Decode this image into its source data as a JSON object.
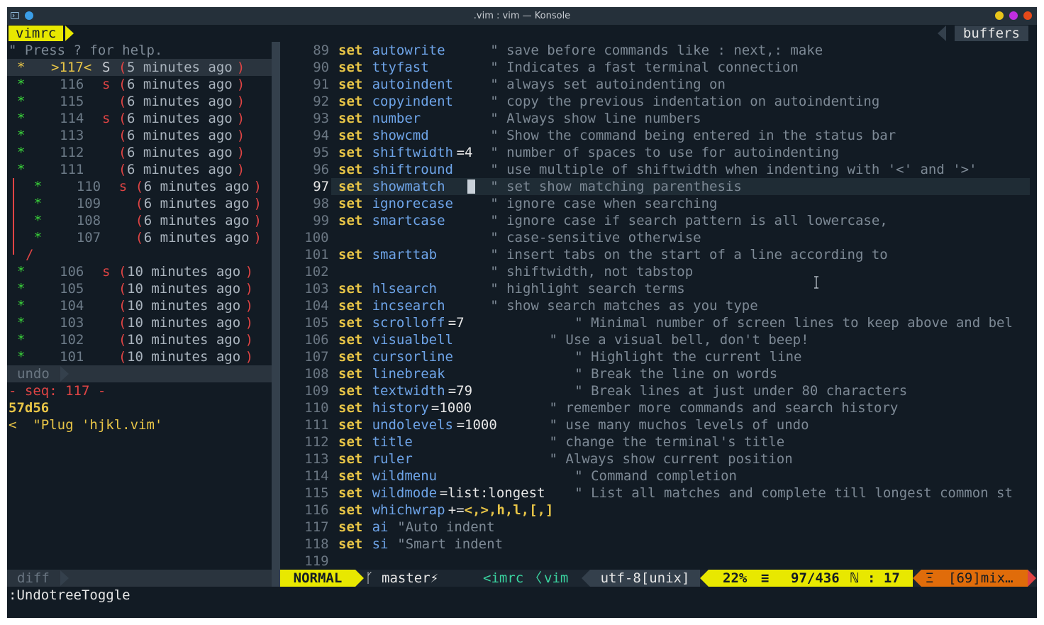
{
  "window": {
    "title": ".vim : vim — Konsole"
  },
  "colors": {
    "accent_yellow": "#e8e800",
    "status_orange": "#e06c0a",
    "bg": "#121b24"
  },
  "tabline": {
    "left_tab": "vimrc",
    "right_tab": "buffers"
  },
  "undotree": {
    "help": "\" Press ? for help.",
    "entries": [
      {
        "star": "*",
        "seq": ">117<",
        "flag": "S",
        "time": "5 minutes ago"
      },
      {
        "star": "*",
        "seq": "116",
        "flag": "s",
        "time": "6 minutes ago"
      },
      {
        "star": "*",
        "seq": "115",
        "flag": "",
        "time": "6 minutes ago"
      },
      {
        "star": "*",
        "seq": "114",
        "flag": "s",
        "time": "6 minutes ago"
      },
      {
        "star": "*",
        "seq": "113",
        "flag": "",
        "time": "6 minutes ago"
      },
      {
        "star": "*",
        "seq": "112",
        "flag": "",
        "time": "6 minutes ago"
      },
      {
        "star": "*",
        "seq": "111",
        "flag": "",
        "time": "6 minutes ago"
      },
      {
        "star": "*",
        "seq": "110",
        "flag": "s",
        "time": "6 minutes ago"
      },
      {
        "star": "*",
        "seq": "109",
        "flag": "",
        "time": "6 minutes ago"
      },
      {
        "star": "*",
        "seq": "108",
        "flag": "",
        "time": "6 minutes ago"
      },
      {
        "star": "*",
        "seq": "107",
        "flag": "",
        "time": "6 minutes ago"
      },
      {
        "star": "*",
        "seq": "106",
        "flag": "s",
        "time": "10 minutes ago"
      },
      {
        "star": "*",
        "seq": "105",
        "flag": "",
        "time": "10 minutes ago"
      },
      {
        "star": "*",
        "seq": "104",
        "flag": "",
        "time": "10 minutes ago"
      },
      {
        "star": "*",
        "seq": "103",
        "flag": "",
        "time": "10 minutes ago"
      },
      {
        "star": "*",
        "seq": "102",
        "flag": "",
        "time": "10 minutes ago"
      },
      {
        "star": "*",
        "seq": "101",
        "flag": "",
        "time": "10 minutes ago"
      }
    ],
    "branch_join": "/",
    "status": "undo",
    "diff_seq": "- seq: 117 -",
    "diff_hunk": "57d56",
    "diff_line": "<  \"Plug 'hjkl.vim'",
    "diff_status": "diff"
  },
  "editor": {
    "current_line": "97",
    "lines": [
      {
        "n": "89",
        "set": "set",
        "opt": "autowrite",
        "val": "",
        "com": "\" save before commands like : next,: make"
      },
      {
        "n": "90",
        "set": "set",
        "opt": "ttyfast",
        "val": "",
        "com": "\" Indicates a fast terminal connection"
      },
      {
        "n": "91",
        "set": "set",
        "opt": "autoindent",
        "val": "",
        "com": "\" always set autoindenting on"
      },
      {
        "n": "92",
        "set": "set",
        "opt": "copyindent",
        "val": "",
        "com": "\" copy the previous indentation on autoindenting"
      },
      {
        "n": "93",
        "set": "set",
        "opt": "number",
        "val": "",
        "com": "\" Always show line numbers"
      },
      {
        "n": "94",
        "set": "set",
        "opt": "showcmd",
        "val": "",
        "com": "\" Show the command being entered in the status bar"
      },
      {
        "n": "95",
        "set": "set",
        "opt": "shiftwidth",
        "val": "=4",
        "com": "\" number of spaces to use for autoindenting"
      },
      {
        "n": "96",
        "set": "set",
        "opt": "shiftround",
        "val": "",
        "com": "\" use multiple of shiftwidth when indenting with '<' and '>'"
      },
      {
        "n": "97",
        "set": "set",
        "opt": "showmatch",
        "val": "",
        "com": "\" set show matching parenthesis"
      },
      {
        "n": "98",
        "set": "set",
        "opt": "ignorecase",
        "val": "",
        "com": "\" ignore case when searching"
      },
      {
        "n": "99",
        "set": "set",
        "opt": "smartcase",
        "val": "",
        "com": "\" ignore case if search pattern is all lowercase,"
      },
      {
        "n": "100",
        "set": "",
        "opt": "",
        "val": "",
        "com": "\" case-sensitive otherwise"
      },
      {
        "n": "101",
        "set": "set",
        "opt": "smarttab",
        "val": "",
        "com": "\" insert tabs on the start of a line according to"
      },
      {
        "n": "102",
        "set": "",
        "opt": "",
        "val": "",
        "com": "\" shiftwidth, not tabstop"
      },
      {
        "n": "103",
        "set": "set",
        "opt": "hlsearch",
        "val": "",
        "com": "\" highlight search terms"
      },
      {
        "n": "104",
        "set": "set",
        "opt": "incsearch",
        "val": "",
        "com": "\" show search matches as you type"
      },
      {
        "n": "105",
        "set": "set",
        "opt": "scrolloff",
        "val": "=7",
        "com": "\" Minimal number of screen lines to keep above and bel"
      },
      {
        "n": "106",
        "set": "set",
        "opt": "visualbell",
        "val": "",
        "com": "\" Use a visual bell, don't beep!"
      },
      {
        "n": "107",
        "set": "set",
        "opt": "cursorline",
        "val": "",
        "com": "\" Highlight the current line"
      },
      {
        "n": "108",
        "set": "set",
        "opt": "linebreak",
        "val": "",
        "com": "\" Break the line on words"
      },
      {
        "n": "109",
        "set": "set",
        "opt": "textwidth",
        "val": "=79",
        "com": "\" Break lines at just under 80 characters"
      },
      {
        "n": "110",
        "set": "set",
        "opt": "history",
        "val": "=1000",
        "com": "\" remember more commands and search history"
      },
      {
        "n": "111",
        "set": "set",
        "opt": "undolevels",
        "val": "=1000",
        "com": "\" use many muchos levels of undo"
      },
      {
        "n": "112",
        "set": "set",
        "opt": "title",
        "val": "",
        "com": "\" change the terminal's title"
      },
      {
        "n": "113",
        "set": "set",
        "opt": "ruler",
        "val": "",
        "com": "\" Always show current position"
      },
      {
        "n": "114",
        "set": "set",
        "opt": "wildmenu",
        "val": "",
        "com": "\" Command completion"
      },
      {
        "n": "115",
        "set": "set",
        "opt": "wildmode",
        "val": "=list:longest",
        "com": "\" List all matches and complete till longest common st"
      },
      {
        "n": "116",
        "set": "set",
        "opt": "whichwrap",
        "val": "+=<,>,h,l,[,]",
        "com": ""
      },
      {
        "n": "117",
        "set": "set",
        "opt": "ai",
        "val": "",
        "com": "\"Auto indent"
      },
      {
        "n": "118",
        "set": "set",
        "opt": "si",
        "val": "",
        "com": "\"Smart indent"
      },
      {
        "n": "119",
        "set": "",
        "opt": "",
        "val": "",
        "com": ""
      }
    ]
  },
  "statusline": {
    "mode": "NORMAL",
    "branch_icon": "ᚴ",
    "branch": "master⚡",
    "file": "<imrc",
    "sep_glyph": "〈",
    "filetype": "vim",
    "encoding": "utf-8[unix]",
    "percent": "22%",
    "lines_icon": "≡",
    "position": "97/436",
    "col_icon": "ℕ",
    "column": ": 17",
    "warn_icon": "Ξ",
    "warnings": "[69]mix…"
  },
  "cmdline": ":UndotreeToggle"
}
